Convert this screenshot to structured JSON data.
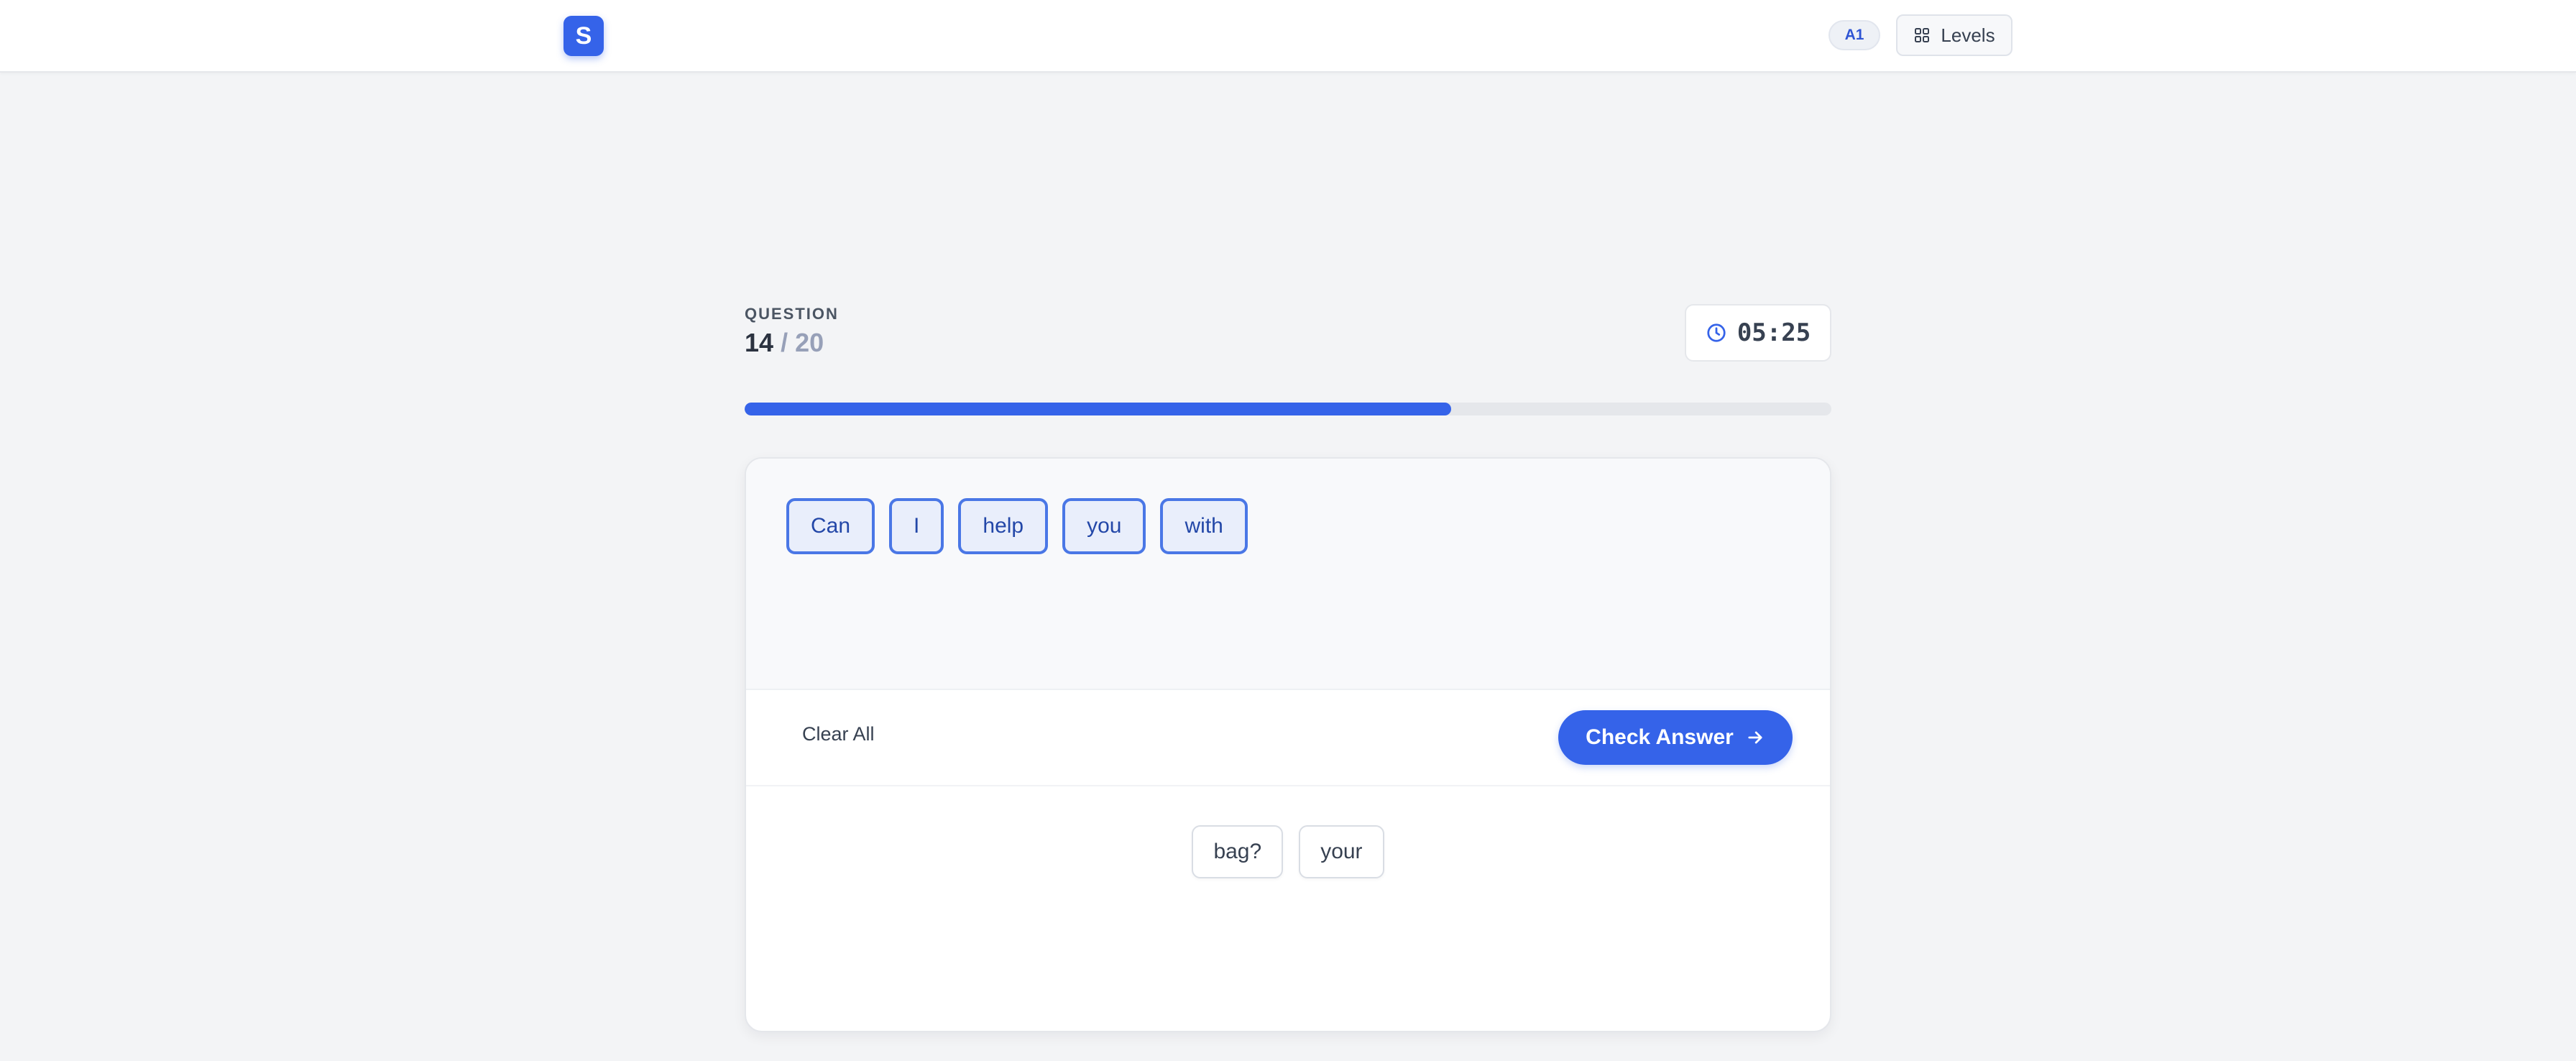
{
  "header": {
    "logo_letter": "S",
    "level_badge": "A1",
    "levels_label": "Levels"
  },
  "question": {
    "label": "QUESTION",
    "current": "14",
    "total": "/ 20",
    "progress_fraction": 0.65
  },
  "timer": {
    "value": "05:25"
  },
  "answer_words": [
    "Can",
    "I",
    "help",
    "you",
    "with"
  ],
  "actions": {
    "clear_label": "Clear All",
    "check_label": "Check Answer"
  },
  "word_bank": [
    "bag?",
    "your"
  ],
  "colors": {
    "accent": "#3563e9",
    "background": "#f3f4f6"
  }
}
